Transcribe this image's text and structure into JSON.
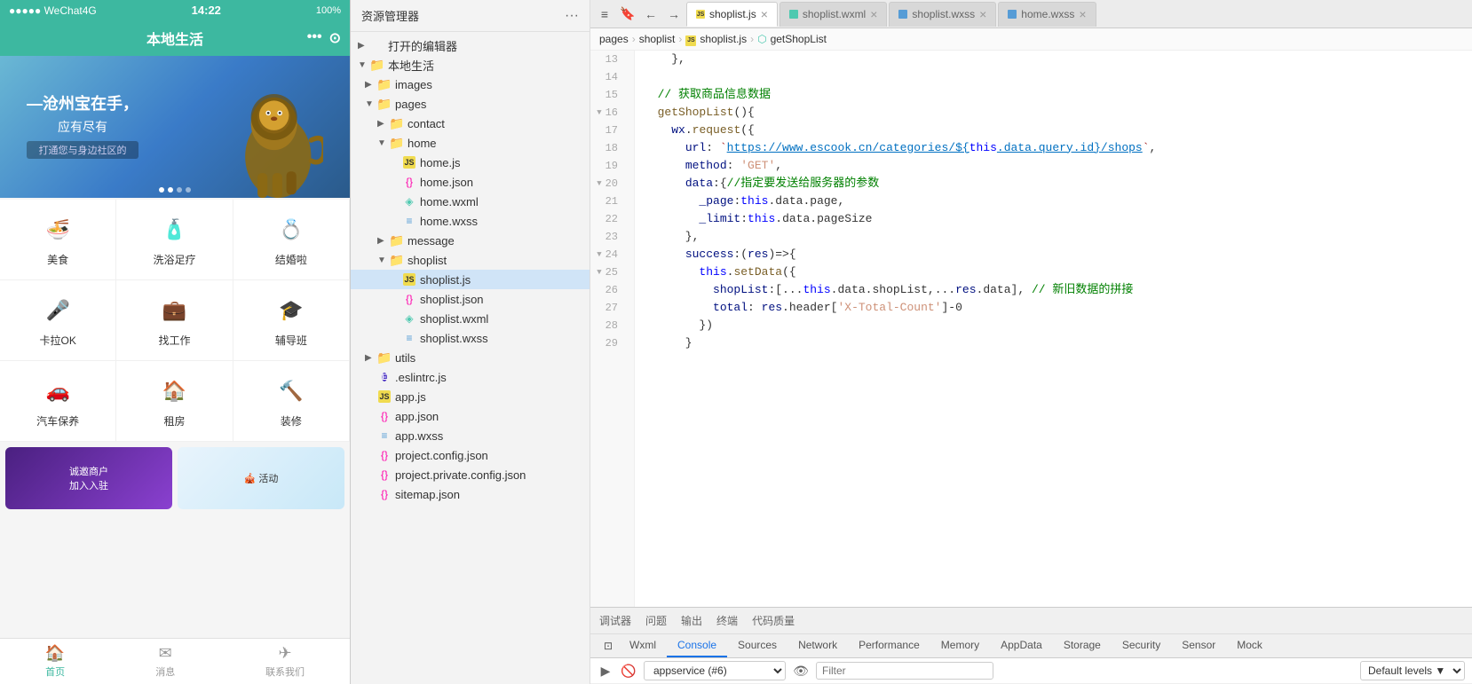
{
  "phone": {
    "status_bar": {
      "signal": "●●●●● WeChat4G",
      "time": "14:22",
      "battery": "100%"
    },
    "title": "本地生活",
    "banner": {
      "line1": "—沧州宝在手，",
      "line2": "应有尽有",
      "line3": "打通您与身边社区的",
      "dots": [
        true,
        true,
        false,
        false
      ]
    },
    "grid": [
      {
        "label": "美食",
        "icon": "🍜",
        "color": "#ff8c00"
      },
      {
        "label": "洗浴足疗",
        "icon": "🧴",
        "color": "#00bcd4"
      },
      {
        "label": "结婚啦",
        "icon": "💍",
        "color": "#ff69b4"
      },
      {
        "label": "卡拉OK",
        "icon": "🎤",
        "color": "#ff6600"
      },
      {
        "label": "找工作",
        "icon": "💼",
        "color": "#4caf50"
      },
      {
        "label": "辅导班",
        "icon": "🎓",
        "color": "#9c27b0"
      },
      {
        "label": "汽车保养",
        "icon": "🚗",
        "color": "#2196f3"
      },
      {
        "label": "租房",
        "icon": "🏠",
        "color": "#ff5722"
      },
      {
        "label": "装修",
        "icon": "🔨",
        "color": "#795548"
      }
    ],
    "nav": [
      {
        "label": "首页",
        "active": true,
        "icon": "🏠"
      },
      {
        "label": "消息",
        "active": false,
        "icon": "✉"
      },
      {
        "label": "联系我们",
        "active": false,
        "icon": "✈"
      }
    ]
  },
  "file_explorer": {
    "title": "资源管理器",
    "sections": {
      "open_editors": "打开的编辑器",
      "project": "本地生活"
    },
    "tree": [
      {
        "id": "open-editors",
        "label": "打开的编辑器",
        "indent": 0,
        "type": "section",
        "collapsed": true
      },
      {
        "id": "project-root",
        "label": "本地生活",
        "indent": 0,
        "type": "folder",
        "collapsed": false
      },
      {
        "id": "images",
        "label": "images",
        "indent": 1,
        "type": "folder",
        "collapsed": true
      },
      {
        "id": "pages",
        "label": "pages",
        "indent": 1,
        "type": "folder",
        "collapsed": false
      },
      {
        "id": "contact",
        "label": "contact",
        "indent": 2,
        "type": "folder",
        "collapsed": true
      },
      {
        "id": "home-folder",
        "label": "home",
        "indent": 2,
        "type": "folder",
        "collapsed": false
      },
      {
        "id": "home-js",
        "label": "home.js",
        "indent": 3,
        "type": "js"
      },
      {
        "id": "home-json",
        "label": "home.json",
        "indent": 3,
        "type": "json"
      },
      {
        "id": "home-wxml",
        "label": "home.wxml",
        "indent": 3,
        "type": "wxml"
      },
      {
        "id": "home-wxss",
        "label": "home.wxss",
        "indent": 3,
        "type": "wxss"
      },
      {
        "id": "message",
        "label": "message",
        "indent": 2,
        "type": "folder",
        "collapsed": true
      },
      {
        "id": "shoplist-folder",
        "label": "shoplist",
        "indent": 2,
        "type": "folder",
        "collapsed": false
      },
      {
        "id": "shoplist-js",
        "label": "shoplist.js",
        "indent": 3,
        "type": "js",
        "selected": true
      },
      {
        "id": "shoplist-json",
        "label": "shoplist.json",
        "indent": 3,
        "type": "json"
      },
      {
        "id": "shoplist-wxml",
        "label": "shoplist.wxml",
        "indent": 3,
        "type": "wxml"
      },
      {
        "id": "shoplist-wxss",
        "label": "shoplist.wxss",
        "indent": 3,
        "type": "wxss"
      },
      {
        "id": "utils",
        "label": "utils",
        "indent": 1,
        "type": "folder",
        "collapsed": true
      },
      {
        "id": "eslint",
        "label": ".eslintrc.js",
        "indent": 1,
        "type": "eslint"
      },
      {
        "id": "app-js",
        "label": "app.js",
        "indent": 1,
        "type": "js"
      },
      {
        "id": "app-json",
        "label": "app.json",
        "indent": 1,
        "type": "json"
      },
      {
        "id": "app-wxss",
        "label": "app.wxss",
        "indent": 1,
        "type": "wxss"
      },
      {
        "id": "project-config",
        "label": "project.config.json",
        "indent": 1,
        "type": "json"
      },
      {
        "id": "project-private",
        "label": "project.private.config.json",
        "indent": 1,
        "type": "json"
      },
      {
        "id": "sitemap",
        "label": "sitemap.json",
        "indent": 1,
        "type": "json"
      }
    ]
  },
  "editor": {
    "tabs": [
      {
        "id": "shoplist-js",
        "label": "shoplist.js",
        "type": "js",
        "active": true
      },
      {
        "id": "shoplist-wxml",
        "label": "shoplist.wxml",
        "type": "wxml",
        "active": false
      },
      {
        "id": "shoplist-wxss",
        "label": "shoplist.wxss",
        "type": "wxss",
        "active": false
      },
      {
        "id": "home-wxss",
        "label": "home.wxss",
        "type": "wxss",
        "active": false
      }
    ],
    "breadcrumb": [
      "pages",
      "shoplist",
      "shoplist.js",
      "getShopList"
    ],
    "lines": {
      "13": "    },",
      "14": "",
      "15": "  // 获取商品信息数据",
      "16": "  getShopList(){",
      "17": "    wx.request({",
      "18": "      url: `https://www.escook.cn/categories/${this.data.query.id}/shops`,",
      "19": "      method: 'GET',",
      "20": "      data:{//指定要发送给服务器的参数",
      "21": "        _page:this.data.page,",
      "22": "        _limit:this.data.pageSize",
      "23": "      },",
      "24": "      success:(res)=>{",
      "25": "        this.setData({",
      "26": "          shopList:[...this.data.shopList,...res.data], // 新旧数据的拼接",
      "27": "          total: res.header['X-Total-Count']-0",
      "28": "        })",
      "29": "      }"
    }
  },
  "devtools": {
    "top_tabs": [
      "调试器",
      "问题",
      "输出",
      "终端",
      "代码质量"
    ],
    "tabs": [
      "Wxml",
      "Console",
      "Sources",
      "Network",
      "Performance",
      "Memory",
      "AppData",
      "Storage",
      "Security",
      "Sensor",
      "Mock"
    ],
    "active_tab": "Console",
    "service": "appservice (#6)",
    "filter_placeholder": "Filter",
    "levels_label": "Default levels ▼"
  }
}
